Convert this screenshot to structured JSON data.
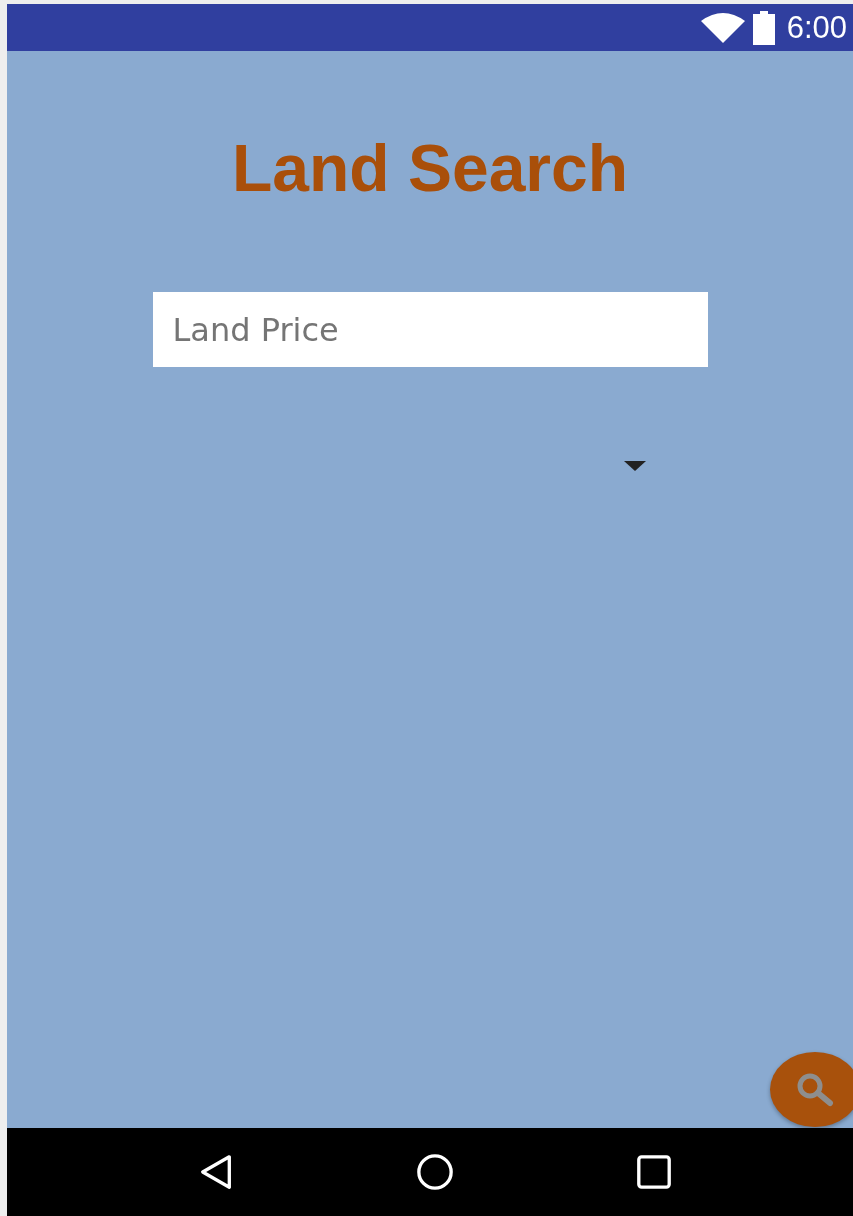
{
  "status_bar": {
    "time": "6:00"
  },
  "title": "Land Search",
  "price_field": {
    "placeholder": "Land Price"
  }
}
